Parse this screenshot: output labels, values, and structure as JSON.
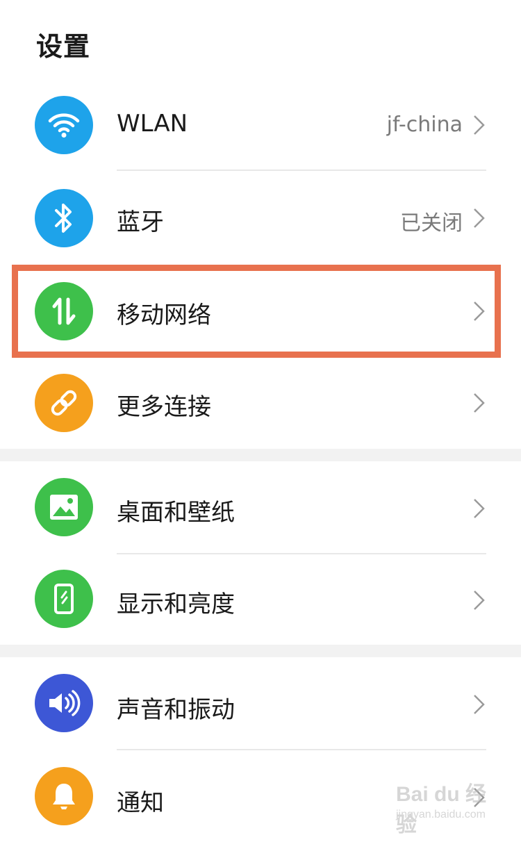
{
  "header": {
    "title": "设置"
  },
  "groups": [
    {
      "items": [
        {
          "label": "WLAN",
          "value": "jf-china",
          "icon": "wifi-icon",
          "color": "#1ea3ea"
        },
        {
          "label": "蓝牙",
          "value": "已关闭",
          "icon": "bluetooth-icon",
          "color": "#1ea3ea"
        },
        {
          "label": "移动网络",
          "value": "",
          "icon": "mobile-data-icon",
          "color": "#3ec04b",
          "highlighted": true
        },
        {
          "label": "更多连接",
          "value": "",
          "icon": "link-icon",
          "color": "#f5a01d"
        }
      ]
    },
    {
      "items": [
        {
          "label": "桌面和壁纸",
          "value": "",
          "icon": "wallpaper-icon",
          "color": "#3ec04b"
        },
        {
          "label": "显示和亮度",
          "value": "",
          "icon": "display-icon",
          "color": "#3ec04b"
        }
      ]
    },
    {
      "items": [
        {
          "label": "声音和振动",
          "value": "",
          "icon": "sound-icon",
          "color": "#3d57d6"
        },
        {
          "label": "通知",
          "value": "",
          "icon": "bell-icon",
          "color": "#f5a01d"
        }
      ]
    }
  ],
  "watermark": {
    "text": "Bai du 经验",
    "sub": "jingyan.baidu.com"
  },
  "colors": {
    "highlight_border": "#e8714e",
    "separator": "#f2f2f2",
    "divider": "#e8e8e8"
  }
}
